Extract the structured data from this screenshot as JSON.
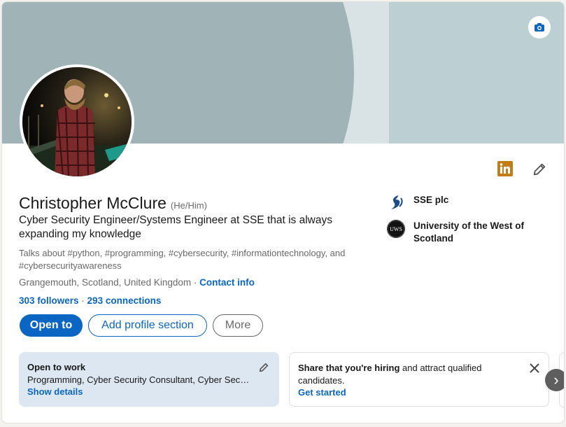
{
  "profile": {
    "name": "Christopher McClure",
    "pronouns": "(He/Him)",
    "headline": "Cyber Security Engineer/Systems Engineer at SSE that is always expanding my knowledge",
    "talks_about": "Talks about #python, #programming, #cybersecurity, #informationtechnology, and #cybersecurityawareness",
    "location": "Grangemouth, Scotland, United Kingdom",
    "location_sep": " · ",
    "contact_info_label": "Contact info",
    "followers": "303 followers",
    "conn_sep": " · ",
    "connections": "293 connections"
  },
  "actions": {
    "open_to": "Open to",
    "add_section": "Add profile section",
    "more": "More"
  },
  "orgs": [
    {
      "label": "SSE plc",
      "icon": "sse-logo"
    },
    {
      "label": "University of the West of Scotland",
      "icon": "uws-logo"
    }
  ],
  "open_to_work": {
    "title": "Open to work",
    "desc": "Programming, Cyber Security Consultant, Cyber Security Engineer",
    "action": "Show details"
  },
  "hiring": {
    "title": "Share that you're hiring",
    "text": " and attract qualified candidates.",
    "action": "Get started"
  },
  "icons": {
    "camera": "camera-icon",
    "linkedin": "linkedin-icon",
    "edit": "pencil-icon",
    "close": "close-icon",
    "next": "chevron-right-icon"
  },
  "colors": {
    "accent": "#0a66c2",
    "banner_dark": "#a0b4b7",
    "banner_light": "#bcd0d4",
    "open_to_work_bg": "#dde7f1",
    "linkedin_badge": "#c37d16"
  }
}
